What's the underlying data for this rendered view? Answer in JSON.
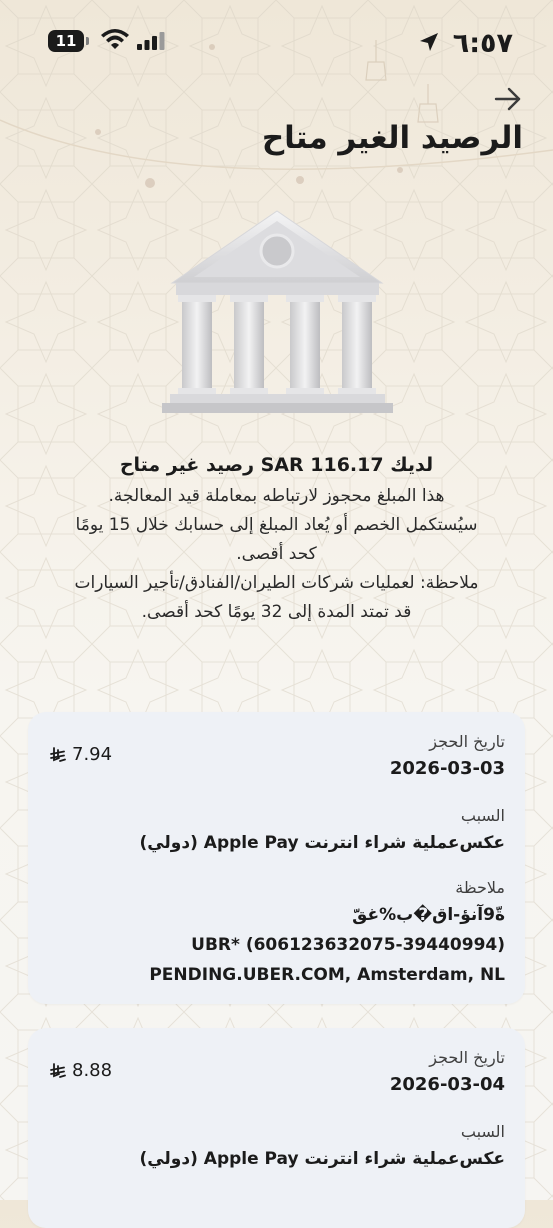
{
  "status_bar": {
    "time": "٦:٥٧",
    "battery": "11"
  },
  "page": {
    "title": "الرصيد الغير متاح"
  },
  "info": {
    "headline": "لديك SAR 116.17 رصيد غير متاح",
    "line1": "هذا المبلغ محجوز لارتباطه بمعاملة قيد المعالجة.",
    "line2": "سيُستكمل الخصم أو يُعاد المبلغ إلى حسابك خلال 15 يومًا",
    "line3": "كحد أقصى.",
    "line4": "ملاحظة: لعمليات شركات الطيران/الفنادق/تأجير السيارات",
    "line5": "قد تمتد المدة إلى 32 يومًا كحد أقصى."
  },
  "transactions": [
    {
      "date_label": "تاريخ الحجز",
      "date": "2026-03-03",
      "amount": "7.94",
      "reason_label": "السبب",
      "reason": "عكس‌عملية شراء انترنت Apple Pay (دولي)",
      "note_label": "ملاحظة",
      "note_line1": "ةّ9آ‌نؤ-اق�ب%غقّ",
      "note_line2": "UBR* (606123632075-39440994)",
      "note_line3": "PENDING.UBER.COM, Amsterdam, NL"
    },
    {
      "date_label": "تاريخ الحجز",
      "date": "2026-03-04",
      "amount": "8.88",
      "reason_label": "السبب",
      "reason": "عكس‌عملية شراء انترنت Apple Pay (دولي)"
    }
  ],
  "colors": {
    "card_bg": "#eef1f6",
    "text": "#1b1b1b",
    "background": "#f3ede2"
  },
  "icons": {
    "back": "arrow-right-icon",
    "currency": "saudi-riyal-icon",
    "illustration": "bank-building-icon"
  }
}
